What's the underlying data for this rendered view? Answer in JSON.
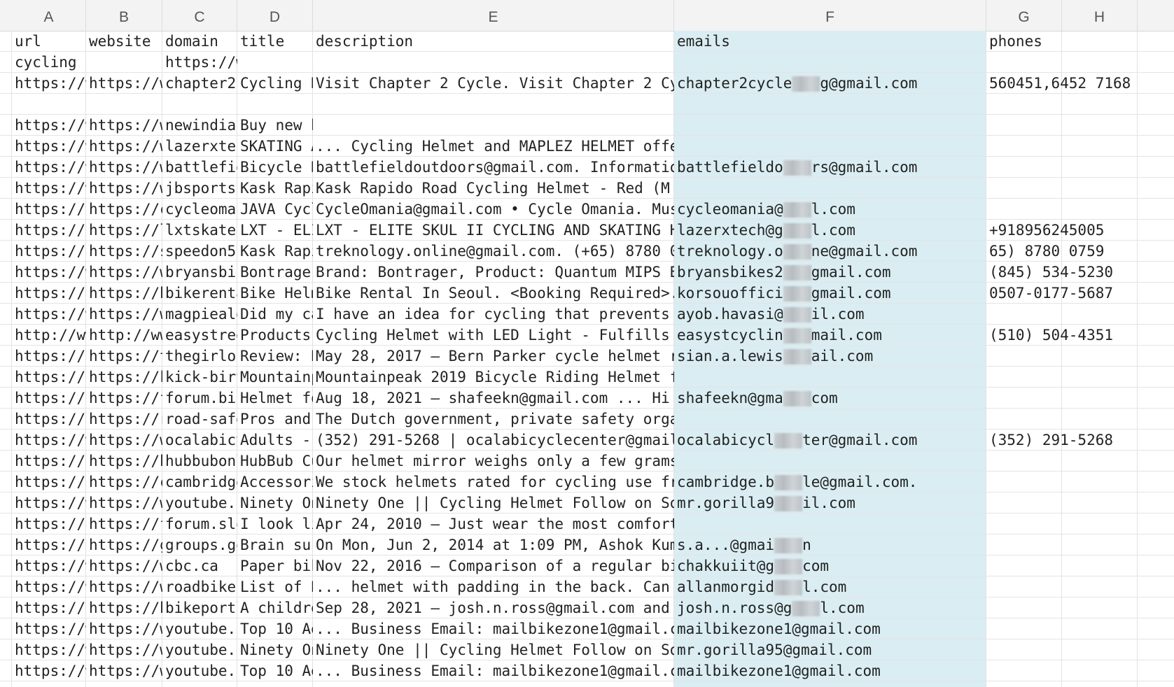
{
  "columns": [
    "A",
    "B",
    "C",
    "D",
    "E",
    "F",
    "G",
    "H"
  ],
  "rows": [
    {
      "a": "url",
      "b": "website",
      "c": "domain",
      "d": "title",
      "e": "description",
      "f": "emails",
      "g": "phones"
    },
    {
      "a": "cycling h",
      "b": "",
      "c": "https://w",
      "d": "",
      "e": "",
      "f": "",
      "g": ""
    },
    {
      "a": "https://w",
      "b": "https://w",
      "c": "chapter2c",
      "d": "Cycling H",
      "e": "Visit Chapter 2 Cycle. Visit Chapter 2 Cycl",
      "f": "chapter2cycle",
      "f2": "g@gmail.com",
      "g": "560451,6452 7168"
    },
    {
      "a": "",
      "b": "",
      "c": "",
      "d": "",
      "e": "",
      "f": "",
      "g": ""
    },
    {
      "a": "https://w",
      "b": "https://w",
      "c": "newindiar",
      "d": "Buy new b",
      "e": "",
      "f": "",
      "g": ""
    },
    {
      "a": "https://w",
      "b": "https://w",
      "c": "lazerxtec",
      "d": "SKATING A",
      "e": "... Cycling Helmet and MAPLEZ HELMET offere",
      "f": "",
      "g": ""
    },
    {
      "a": "https://w",
      "b": "https://w",
      "c": "battlefie",
      "d": "Bicycle H",
      "e": "battlefieldoutdoors@gmail.com. Information.",
      "f": "battlefieldo",
      "f2": "rs@gmail.com",
      "g": ""
    },
    {
      "a": "https://w",
      "b": "https://w",
      "c": "jbsports.",
      "d": "Kask Rapi",
      "e": "Kask Rapido Road Cycling Helmet - Red (M 58",
      "f": "",
      "g": ""
    },
    {
      "a": "https://c",
      "b": "https://c",
      "c": "cycleomar",
      "d": "JAVA Cycl",
      "e": "CycleOmania@gmail.com • Cycle Omania. Musc",
      "f": "cycleomania@",
      "f2": "l.com",
      "g": ""
    },
    {
      "a": "https://l",
      "b": "https://l",
      "c": "lxtskates",
      "d": "LXT - ELI",
      "e": "LXT - ELITE SKUL II CYCLING AND SKATING HEI",
      "f": "lazerxtech@g",
      "f2": "l.com",
      "g": "+918956245005"
    },
    {
      "a": "https://s",
      "b": "https://s",
      "c": "speedon5.",
      "d": "Kask Rapi",
      "e": "treknology.online@gmail.com. (+65) 8780 075",
      "f": "treknology.o",
      "f2": "ne@gmail.com",
      "g": "65) 8780 0759"
    },
    {
      "a": "https://w",
      "b": "https://w",
      "c": "bryansbik",
      "d": "Bontrager",
      "e": "Brand: Bontrager, Product: Quantum MIPS Bik",
      "f": "bryansbikes2",
      "f2": "gmail.com",
      "g": "(845) 534-5230"
    },
    {
      "a": "https://b",
      "b": "https://b",
      "c": "bikerenta",
      "d": "Bike Helm",
      "e": "Bike Rental In Seoul. <Booking Required>. M",
      "f": "korsouoffici",
      "f2": "gmail.com",
      "g": "0507-0177-5687"
    },
    {
      "a": "https://w",
      "b": "https://w",
      "c": "magpieale",
      "d": "Did my ca",
      "e": "I have an idea for cycling that prevents bi",
      "f": "ayob.havasi@",
      "f2": "il.com",
      "g": ""
    },
    {
      "a": "http://ww",
      "b": "http://ww",
      "c": "easystree",
      "d": "Products",
      "e": "Cycling Helmet with LED Light - Fulfills He",
      "f": "easystcyclin",
      "f2": "mail.com",
      "g": "(510) 504-4351"
    },
    {
      "a": "https://t",
      "b": "https://t",
      "c": "thegirlou",
      "d": "Review: B",
      "e": "May 28, 2017 — Bern Parker cycle helmet re",
      "f": "sian.a.lewis",
      "f2": "ail.com",
      "g": ""
    },
    {
      "a": "https://k",
      "b": "https://k",
      "c": "kick-birt",
      "d": "Mountainp",
      "e": "Mountainpeak 2019 Bicycle Riding Helmet for",
      "f": "",
      "g": ""
    },
    {
      "a": "https://f",
      "b": "https://f",
      "c": "forum.bik",
      "d": "Helmet fo",
      "e": "Aug 18, 2021 — shafeekn@gmail.com ... Hi a",
      "f": "shafeekn@gma",
      "f2": "com",
      "g": ""
    },
    {
      "a": "https://r",
      "b": "https://r",
      "c": "road-safe",
      "d": "Pros and",
      "e": "The Dutch government, private safety organi",
      "f": "",
      "g": ""
    },
    {
      "a": "https://w",
      "b": "https://w",
      "c": "ocalabicy",
      "d": "Adults -",
      "e": "(352) 291-5268 | ocalabicyclecenter@gmail.c",
      "f": "ocalabicycl",
      "f2": "ter@gmail.com",
      "g": "(352) 291-5268"
    },
    {
      "a": "https://h",
      "b": "https://h",
      "c": "hubbubonl",
      "d": "HubBub Cu",
      "e": "Our helmet mirror weighs only a few grams,",
      "f": "",
      "g": ""
    },
    {
      "a": "https://c",
      "b": "https://c",
      "c": "cambridge",
      "d": "Accessori",
      "e": "We stock helmets rated for cycling use fron",
      "f": "cambridge.b",
      "f2": "le@gmail.com.",
      "g": ""
    },
    {
      "a": "https://w",
      "b": "https://w",
      "c": "youtube.c",
      "d": "Ninety On",
      "e": "Ninety One || Cycling Helmet Follow on Soci",
      "f": "mr.gorilla9",
      "f2": "il.com",
      "g": ""
    },
    {
      "a": "https://f",
      "b": "https://f",
      "c": "forum.slo",
      "d": "I look li",
      "e": "Apr 24, 2010 — Just wear the most comforta",
      "f": "",
      "g": ""
    },
    {
      "a": "https://g",
      "b": "https://g",
      "c": "groups.go",
      "d": "Brain sur",
      "e": "On Mon, Jun 2, 2014 at 1:09 PM, Ashok Kumar",
      "f": "s.a...@gmai",
      "f2": "n",
      "g": ""
    },
    {
      "a": "https://w",
      "b": "https://w",
      "c": "cbc.ca",
      "d": "Paper bik",
      "e": "Nov 22, 2016 — Comparison of a regular bik",
      "f": "chakkuiit@g",
      "f2": "com",
      "g": ""
    },
    {
      "a": "https://w",
      "b": "https://w",
      "c": "roadbiker",
      "d": "List of B",
      "e": "... helmet with padding in the back. Can yo",
      "f": "allanmorgid",
      "f2": "l.com",
      "g": ""
    },
    {
      "a": "https://b",
      "b": "https://b",
      "c": "bikeportl",
      "d": "A childre",
      "e": "Sep 28, 2021 — josh.n.ross@gmail.com and (",
      "f": "josh.n.ross@g",
      "f2": "l.com",
      "g": ""
    },
    {
      "a": "https://w",
      "b": "https://w",
      "c": "youtube.c",
      "d": "Top 10 Ae",
      "e": "... Business Email: mailbikezone1@gmail.com",
      "f": "mailbikezone1@gmail.com",
      "g": ""
    },
    {
      "a": "https://w",
      "b": "https://w",
      "c": "youtube.c",
      "d": "Ninety On",
      "e": "Ninety One || Cycling Helmet Follow on Soci",
      "f": "mr.gorilla95@gmail.com",
      "g": ""
    },
    {
      "a": "https://w",
      "b": "https://w",
      "c": "youtube.c",
      "d": "Top 10 Ae",
      "e": "... Business Email: mailbikezone1@gmail.com",
      "f": "mailbikezone1@gmail.com",
      "g": ""
    }
  ]
}
